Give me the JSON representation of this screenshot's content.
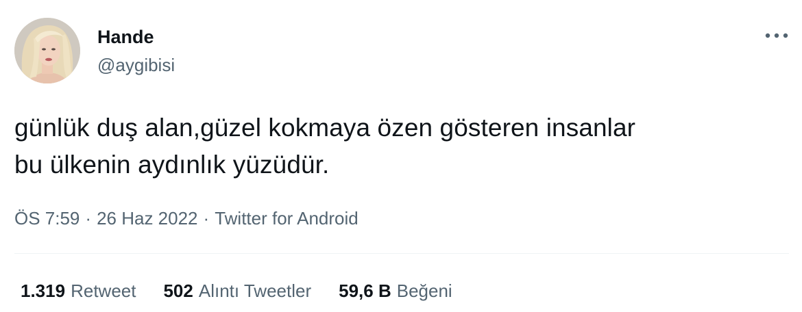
{
  "author": {
    "display_name": "Hande",
    "handle": "@aygibisi",
    "avatar_icon": "profile-photo"
  },
  "tweet": {
    "text": "günlük duş alan,güzel kokmaya özen gösteren insanlar\nbu ülkenin aydınlık yüzüdür."
  },
  "meta": {
    "time": "ÖS 7:59",
    "separator": "·",
    "date": "26 Haz 2022",
    "source": "Twitter for Android"
  },
  "stats": {
    "retweets": {
      "count": "1.319",
      "label": "Retweet"
    },
    "quotes": {
      "count": "502",
      "label": "Alıntı Tweetler"
    },
    "likes": {
      "count": "59,6 B",
      "label": "Beğeni"
    }
  },
  "colors": {
    "text_primary": "#0f1419",
    "text_secondary": "#536471",
    "divider": "#eff3f4"
  }
}
